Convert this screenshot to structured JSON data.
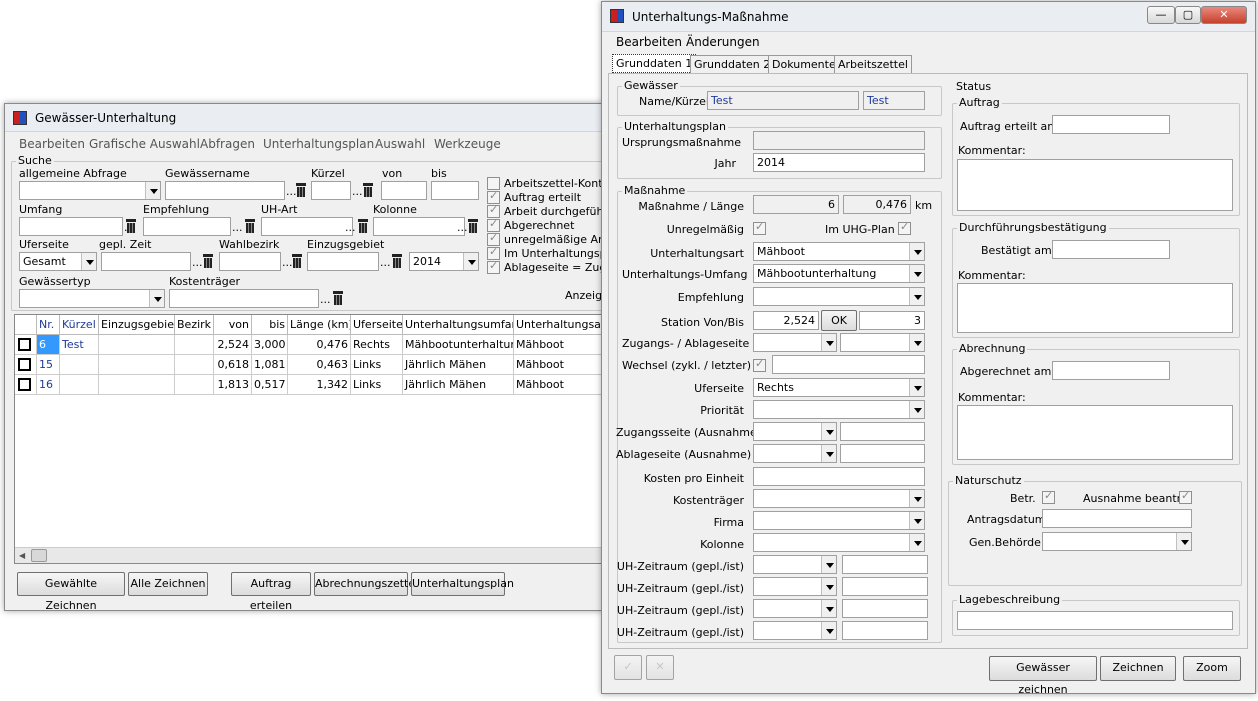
{
  "left": {
    "title": "Gewässer-Unterhaltung",
    "menu": [
      "Bearbeiten",
      "Grafische Auswahl",
      "Abfragen",
      "Unterhaltungsplan",
      "Auswahl",
      "Werkzeuge"
    ],
    "search": {
      "group": "Suche",
      "lbl_abfrage": "allgemeine Abfrage",
      "lbl_gewname": "Gewässername",
      "lbl_kuerzel": "Kürzel",
      "lbl_von": "von",
      "lbl_bis": "bis",
      "lbl_umfang": "Umfang",
      "lbl_empfehlung": "Empfehlung",
      "lbl_uhart": "UH-Art",
      "lbl_kolonne": "Kolonne",
      "lbl_uferseite": "Uferseite",
      "lbl_geplzeit": "gepl. Zeit",
      "lbl_wahlbezirk": "Wahlbezirk",
      "lbl_einzugsgebiet": "Einzugsgebiet",
      "lbl_gewtyp": "Gewässertyp",
      "lbl_kostentraeger": "Kostenträger",
      "uferseite_value": "Gesamt",
      "year_value": "2014",
      "checks": [
        "Arbeitszettel-Konten",
        "Auftrag erteilt",
        "Arbeit durchgeführt",
        "Abgerechnet",
        "unregelmäßige Arbei",
        "Im Unterhaltungsplan",
        "Ablageseite = Zugan"
      ],
      "anzeige": "Anzeige"
    },
    "table": {
      "headers": [
        "Nr.",
        "Kürzel",
        "Einzugsgebiet",
        "Bezirk",
        "von",
        "bis",
        "Länge (km)",
        "Uferseite",
        "Unterhaltungsumfang",
        "Unterhaltungsart"
      ],
      "rows": [
        [
          "6",
          "Test",
          "",
          "",
          "2,524",
          "3,000",
          "0,476",
          "Rechts",
          "Mähbootunterhaltung",
          "Mähboot"
        ],
        [
          "15",
          "",
          "",
          "",
          "0,618",
          "1,081",
          "0,463",
          "Links",
          "Jährlich Mähen",
          "Mähboot"
        ],
        [
          "16",
          "",
          "",
          "",
          "1,813",
          "0,517",
          "1,342",
          "Links",
          "Jährlich Mähen",
          "Mähboot"
        ]
      ]
    },
    "buttons": [
      "Gewählte Zeichnen",
      "Alle Zeichnen",
      "Auftrag erteilen",
      "Abrechnungszettel",
      "Unterhaltungsplan"
    ]
  },
  "right": {
    "title": "Unterhaltungs-Maßnahme",
    "menu": [
      "Bearbeiten",
      "Änderungen"
    ],
    "tabs": [
      "Grunddaten 1",
      "Grunddaten 2",
      "Dokumente",
      "Arbeitszettel"
    ],
    "gewaesser": {
      "group": "Gewässer",
      "label": "Name/Kürzel",
      "name": "Test",
      "kuerzel": "Test"
    },
    "plan": {
      "group": "Unterhaltungsplan",
      "lbl_ursprung": "Ursprungsmaßnahme",
      "lbl_jahr": "Jahr",
      "jahr": "2014"
    },
    "massnahme": {
      "group": "Maßnahme",
      "lbl_nr": "Maßnahme / Länge",
      "nr": "6",
      "laenge": "0,476",
      "unit": "km",
      "lbl_unregel": "Unregelmäßig",
      "lbl_uhg": "Im UHG-Plan",
      "lbl_art": "Unterhaltungsart",
      "art": "Mähboot",
      "lbl_umfang": "Unterhaltungs-Umfang",
      "umfang": "Mähbootunterhaltung",
      "lbl_empfehlung": "Empfehlung",
      "lbl_station": "Station Von/Bis",
      "station_von": "2,524",
      "ok": "OK",
      "station_bis": "3",
      "lbl_zugang": "Zugangs- / Ablageseite",
      "lbl_wechsel": "Wechsel (zykl. / letzter)",
      "lbl_uferseite": "Uferseite",
      "uferseite": "Rechts",
      "lbl_prioritaet": "Priorität",
      "lbl_zugang_aus": "Zugangsseite (Ausnahme)",
      "lbl_ablage_aus": "Ablageseite (Ausnahme)",
      "lbl_kosten": "Kosten pro Einheit",
      "lbl_kostentraeger": "Kostenträger",
      "lbl_firma": "Firma",
      "lbl_kolonne": "Kolonne",
      "lbl_uhzeit": "UH-Zeitraum (gepl./ist)"
    },
    "status": {
      "group": "Status",
      "auftrag": "Auftrag",
      "auftrag_am": "Auftrag erteilt am:",
      "kommentar": "Kommentar:",
      "durchf": "Durchführungsbestätigung",
      "bestaetigt_am": "Bestätigt am:",
      "abrechnung": "Abrechnung",
      "abgerechnet_am": "Abgerechnet am:"
    },
    "naturschutz": {
      "group": "Naturschutz",
      "betr": "Betr.",
      "ausnahme": "Ausnahme beantr.",
      "antragsdatum": "Antragsdatum",
      "behoerde": "Gen.Behörde"
    },
    "lage": "Lagebeschreibung",
    "buttons": [
      "Gewässer zeichnen",
      "Zeichnen",
      "Zoom"
    ]
  }
}
